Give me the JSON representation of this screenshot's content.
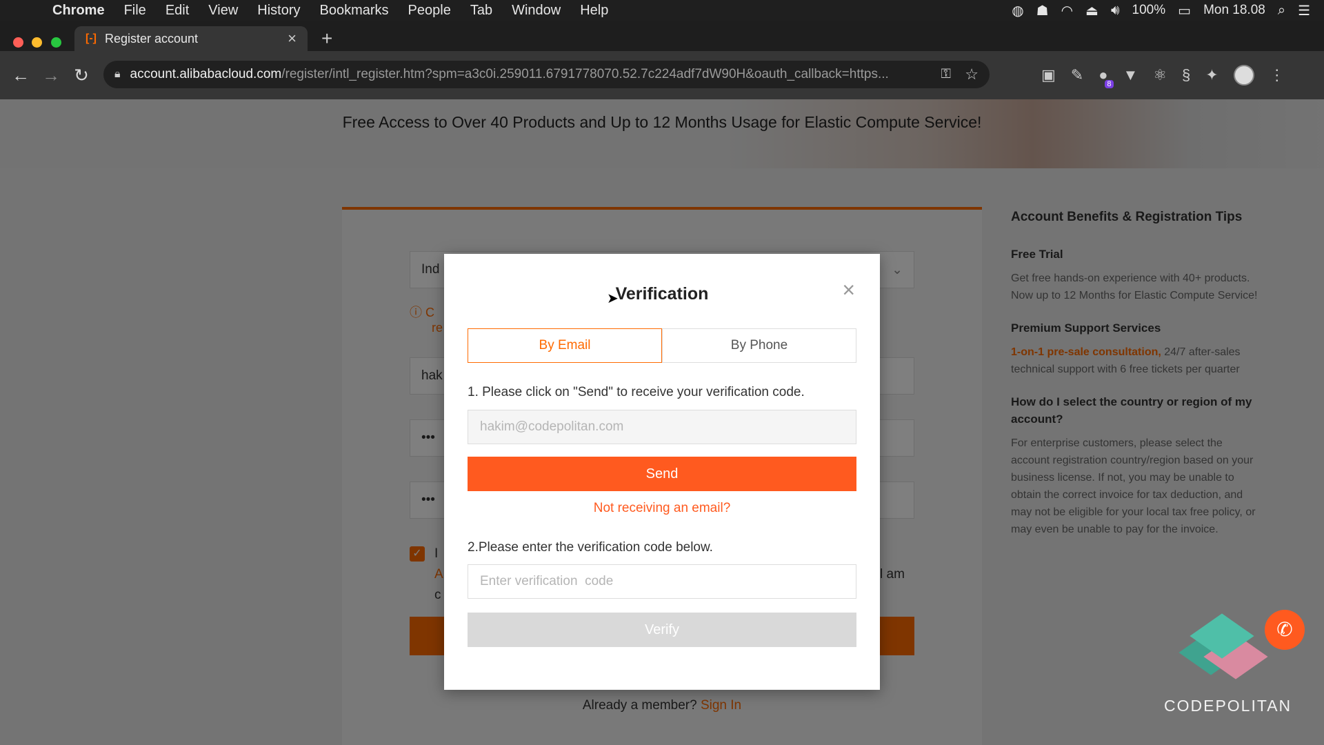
{
  "menubar": {
    "app": "Chrome",
    "items": [
      "File",
      "Edit",
      "View",
      "History",
      "Bookmarks",
      "People",
      "Tab",
      "Window",
      "Help"
    ],
    "battery": "100%",
    "clock": "Mon 18.08"
  },
  "browser": {
    "tab_title": "Register account",
    "url_host": "account.alibabacloud.com",
    "url_path": "/register/intl_register.htm?spm=a3c0i.259011.6791778070.52.7c224adf7dW90H&oauth_callback=https...",
    "extension_badge": "8"
  },
  "page": {
    "banner_text": "Free Access to Over 40 Products and Up to 12 Months Usage for Elastic Compute Service!",
    "bg_fields": {
      "country": "Ind",
      "warning_line1": "C",
      "warning_line2": "re",
      "name": "hak",
      "password": "•••",
      "confirm": "•••",
      "agree_line1": "I",
      "agree_line2": "A",
      "agree_line3": "c",
      "agree_tail": "l am"
    },
    "already_member": "Already a member?",
    "sign_in": "Sign In"
  },
  "sidebar": {
    "title": "Account Benefits & Registration Tips",
    "sections": [
      {
        "heading": "Free Trial",
        "highlight": "",
        "body": "Get free hands-on experience with 40+ products. Now up to 12 Months for Elastic Compute Service!"
      },
      {
        "heading": "Premium Support Services",
        "highlight": "1-on-1 pre-sale consultation,",
        "body": " 24/7 after-sales technical support with 6 free tickets per quarter"
      },
      {
        "heading": "How do I select the country or region of my account?",
        "highlight": "",
        "body": "For enterprise customers, please select the account registration country/region based on your business license. If not, you may be unable to obtain the correct invoice for tax deduction, and may not be eligible for your local tax free policy, or may even be unable to pay for the invoice."
      }
    ]
  },
  "logo_text": "CODEPOLITAN",
  "modal": {
    "title": "Verification",
    "tab_email": "By Email",
    "tab_phone": "By Phone",
    "step1": "1. Please click on \"Send\" to receive your verification code.",
    "email_placeholder": "hakim@codepolitan.com",
    "send_label": "Send",
    "not_receiving": "Not receiving an email?",
    "step2": "2.Please enter the verification code below.",
    "code_placeholder": "Enter verification  code",
    "verify_label": "Verify"
  },
  "colors": {
    "accent": "#ff5a1f",
    "brand_orange": "#ff6a00",
    "disabled": "#d9d9d9"
  }
}
